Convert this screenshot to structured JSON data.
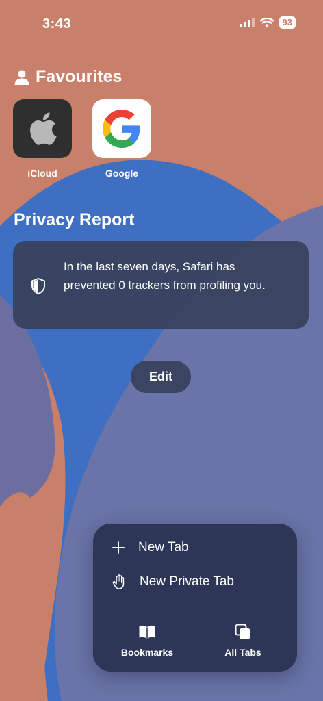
{
  "status_bar": {
    "time": "3:43",
    "battery": "93"
  },
  "favourites": {
    "title": "Favourites",
    "items": [
      {
        "label": "iCloud"
      },
      {
        "label": "Google"
      }
    ]
  },
  "privacy": {
    "title": "Privacy Report",
    "text": "In the last seven days, Safari has prevented 0 trackers from profiling you."
  },
  "edit_label": "Edit",
  "menu": {
    "new_tab": "New Tab",
    "new_private_tab": "New Private Tab",
    "bookmarks": "Bookmarks",
    "all_tabs": "All Tabs"
  },
  "colors": {
    "wallpaper_orange": "#c9806b",
    "wallpaper_blue": "#3e6fc2",
    "wallpaper_periwinkle": "#6a74a8",
    "card": "#37405a",
    "menu": "#2d3657"
  }
}
